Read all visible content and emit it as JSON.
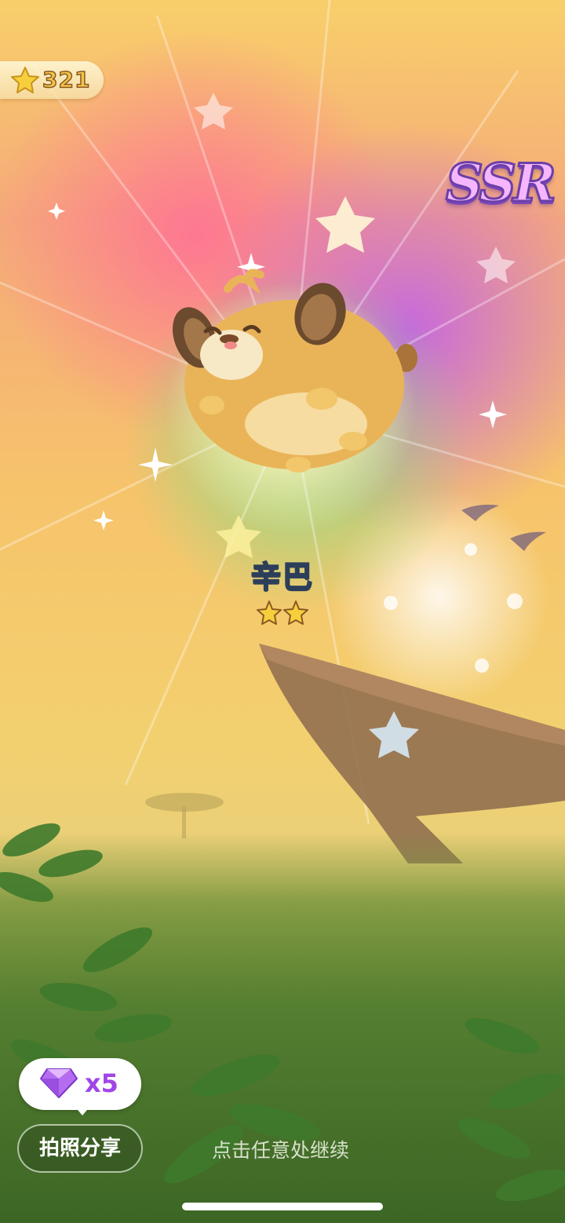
{
  "hud": {
    "score_icon": "star-icon",
    "score_value": "321"
  },
  "rarity": {
    "label": "SSR"
  },
  "character": {
    "name": "辛巴",
    "stars": 2,
    "stars_max": 2
  },
  "reward_bubble": {
    "icon": "gem-icon",
    "count": "x5"
  },
  "share_button": {
    "label": "拍照分享"
  },
  "continue_hint": "点击任意处继续",
  "colors": {
    "gem": "#a046e6",
    "ssr": "#f5b6ff",
    "star": "#f7cf3c"
  }
}
